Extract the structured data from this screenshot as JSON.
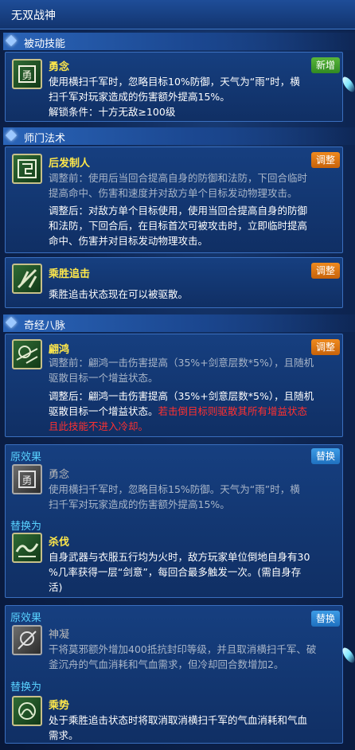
{
  "header": {
    "title": "无双战神"
  },
  "sections": {
    "passive": "被动技能",
    "sect": "师门法术",
    "meridian": "奇经八脉"
  },
  "passive_card": {
    "name": "勇念",
    "badge": "新增",
    "desc1": "使用横扫千军时，忽略目标10%防御，天气为“雨”时，横",
    "desc2": "扫千军对玩家造成的伤害额外提高15%。",
    "unlock": "解锁条件：十方无敌≥100级"
  },
  "sect_card1": {
    "name": "后发制人",
    "badge": "调整",
    "before1": "调整前：使用后当回合提高自身的防御和法防，下回合临时",
    "before2": "提高命中、伤害和速度并对敌方单个目标发动物理攻击。",
    "after1": "调整后：对敌方单个目标使用，使用当回合提高自身的防御",
    "after2": "和法防，下回合后，在目标首次可被攻击时，立即临时提高",
    "after3": "命中、伤害并对目标发动物理攻击。"
  },
  "sect_card2": {
    "name": "乘胜追击",
    "badge": "调整",
    "desc": "乘胜追击状态现在可以被驱散。"
  },
  "meridian_card": {
    "name": "翩鸿",
    "badge": "调整",
    "before1": "调整前：翩鸿一击伤害提高（35%+剑意层数*5%），且随机",
    "before2": "驱散目标一个增益状态。",
    "after1": "调整后：翩鸿一击伤害提高（35%+剑意层数*5%），且随机",
    "after2a": "驱散目标一个增益状态。",
    "after2b": "若击倒目标则驱散其所有增益状态",
    "after3": "且此技能不进入冷却。"
  },
  "replace_card1": {
    "orig_label": "原效果",
    "badge": "替换",
    "orig_name": "勇念",
    "orig1": "使用横扫千军时，忽略目标15%防御。天气为“雨”时，横",
    "orig2": "扫千军对玩家造成的伤害额外提高15%。",
    "new_label": "替换为",
    "new_name": "杀伐",
    "new1": "自身武器与衣服五行均为火时，敌方玩家单位倒地自身有30",
    "new2": "%几率获得一层“剑意”，每回合最多触发一次。(需自身存",
    "new3": "活)"
  },
  "replace_card2": {
    "orig_label": "原效果",
    "badge": "替换",
    "orig_name": "神凝",
    "orig1": "干将莫邪额外增加400抵抗封印等级，并且取消横扫千军、破",
    "orig2": "釜沉舟的气血消耗和气血需求，但冷却回合数增加2。",
    "new_label": "替换为",
    "new_name": "乘势",
    "new1": "处于乘胜追击状态时将取消取消横扫千军的气血消耗和气血",
    "new2": "需求。"
  },
  "icons": [
    "yongnian-icon",
    "houfazhiren-icon",
    "chengsheng-icon",
    "pianhong-icon",
    "shafa-icon",
    "shenning-icon",
    "chengshi-icon"
  ]
}
